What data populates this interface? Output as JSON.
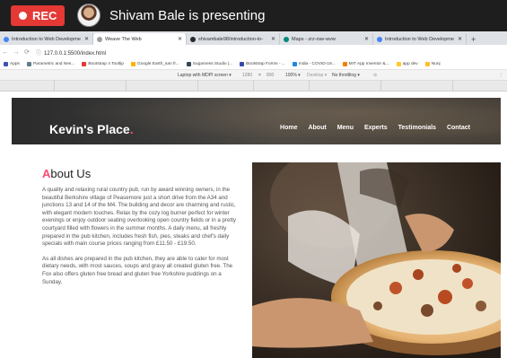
{
  "meeting": {
    "rec_label": "REC",
    "presenter_text": "Shivam Bale is presenting"
  },
  "browser": {
    "tabs": [
      {
        "label": "Introduction to Web Developme",
        "color": "#4285f4",
        "active": false
      },
      {
        "label": "Weave The Web",
        "color": "#9e9e9e",
        "active": true
      },
      {
        "label": "shivambale98/introduction-to-",
        "color": "#24292e",
        "active": false
      },
      {
        "label": "Maps - zrz-nse-wvw",
        "color": "#00897b",
        "active": false
      },
      {
        "label": "Introduction to Web Developme",
        "color": "#4285f4",
        "active": false
      }
    ],
    "new_tab": "+",
    "url": "127.0.0.1:5500/index.html",
    "bookmarks": [
      {
        "label": "Apps",
        "color": "#3f51b5"
      },
      {
        "label": "Parametric and Nes...",
        "color": "#607d8b"
      },
      {
        "label": "Bootstrap 4 Tooltip",
        "color": "#e53935"
      },
      {
        "label": "Google Earth_san fr...",
        "color": "#ffb300"
      },
      {
        "label": "Sugarness Studio |...",
        "color": "#37474f"
      },
      {
        "label": "Bootstrap Forms - ...",
        "color": "#3949ab"
      },
      {
        "label": "India - COVID-19...",
        "color": "#1e88e5"
      },
      {
        "label": "MIT App Inventor &...",
        "color": "#f57c00"
      },
      {
        "label": "app dev",
        "color": "#ffca28"
      },
      {
        "label": "Nunj",
        "color": "#fbc02d"
      }
    ],
    "device_toolbar": {
      "device": "Laptop with MDPI screen ▾",
      "width": "1280",
      "x": "×",
      "height": "800",
      "zoom": "100% ▾",
      "type": "Desktop ▾",
      "throttle": "No throttling ▾"
    }
  },
  "site": {
    "brand": "Kevin's Place",
    "brand_dot": ".",
    "nav": [
      "Home",
      "About",
      "Menu",
      "Experts",
      "Testimonials",
      "Contact"
    ],
    "about_title_first": "A",
    "about_title_rest": "bout Us",
    "about_paragraphs": [
      "A quality and relaxing rural country pub, run by award winning owners, in the beautiful Berkshire village of Peasemore just a short drive from the A34 and junctions 13 and 14 of the M4. The building and decor are charming and rustic, with elegant modern touches. Relax by the cozy log burner perfect for winter evenings or enjoy outdoor seating overlooking open country fields or in a pretty courtyard filled with flowers in the summer months. A daily menu, all freshly prepared in the pub kitchen, includes fresh fish, pies, steaks and chef's daily specials with main course prices ranging from £11.50 - £19.50.",
      "As all dishes are prepared in the pub kitchen, they are able to cater for most dietary needs, with most sauces, soups and gravy all created gluten free. The Fox also offers gluten free bread and gluten free Yorkshire puddings on a Sunday."
    ]
  }
}
